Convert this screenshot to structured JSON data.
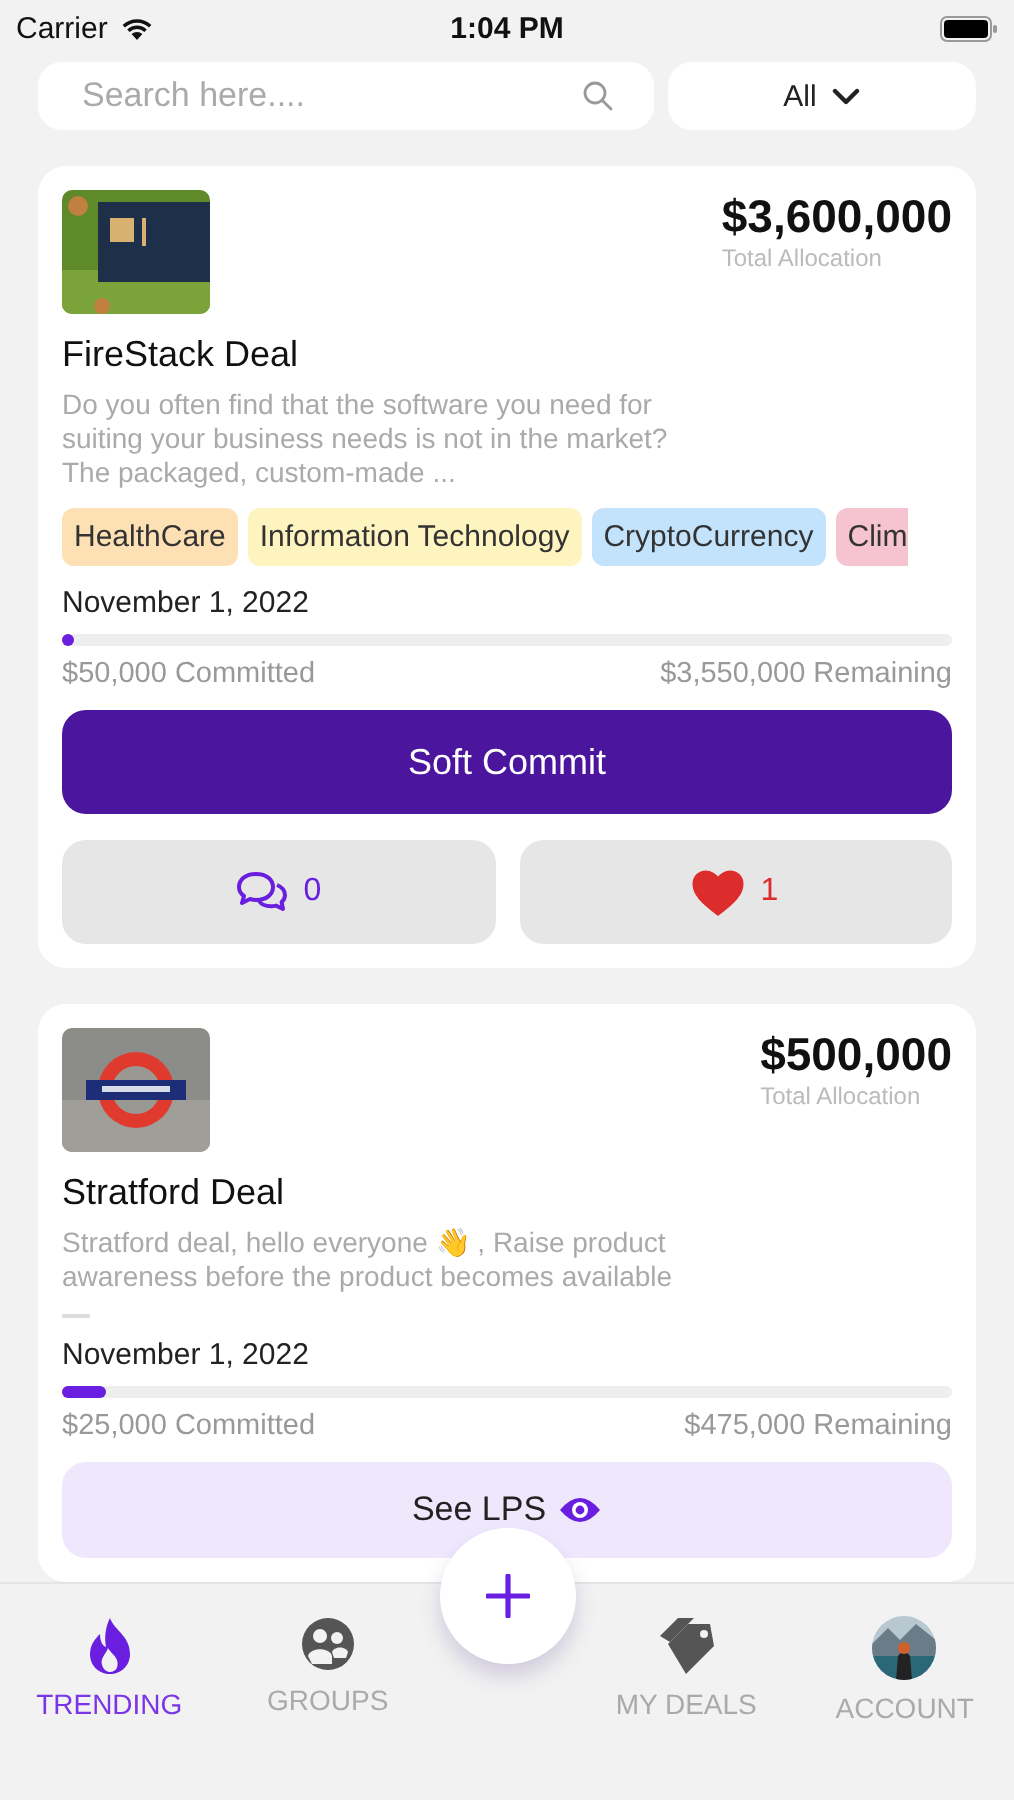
{
  "status_bar": {
    "carrier": "Carrier",
    "time": "1:04 PM"
  },
  "search": {
    "placeholder": "Search here...."
  },
  "filter": {
    "value": "All"
  },
  "deals": [
    {
      "title": "FireStack Deal",
      "amount": "$3,600,000",
      "amount_label": "Total Allocation",
      "description": "Do you often find that the software you need for suiting your business needs is not in the market? The packaged, custom-made ...",
      "tags": [
        {
          "label": "HealthCare",
          "color": "#fde0b4"
        },
        {
          "label": "Information Technology",
          "color": "#fdf4c0"
        },
        {
          "label": "CryptoCurrency",
          "color": "#c3e2fb"
        },
        {
          "label": "Clim",
          "color": "#f6c3d1"
        }
      ],
      "date": "November 1, 2022",
      "level": 0.014,
      "committed": "$50,000 Committed",
      "remaining": "$3,550,000 Remaining",
      "action": {
        "kind": "primary",
        "label": "Soft Commit"
      },
      "comments": "0",
      "likes": "1",
      "liked": true
    },
    {
      "title": "Stratford Deal",
      "amount": "$500,000",
      "amount_label": "Total Allocation",
      "description": "Stratford deal, hello everyone 👋 , Raise product awareness before the product becomes available",
      "date": "November 1, 2022",
      "level": 0.05,
      "committed": "$25,000 Committed",
      "remaining": "$475,000 Remaining",
      "action": {
        "kind": "secondary",
        "label": "See LPS"
      }
    }
  ],
  "tabs": [
    {
      "label": "TRENDING",
      "kind": "flame",
      "selected": true
    },
    {
      "label": "GROUPS",
      "kind": "groups",
      "selected": false
    },
    {
      "label": "MY DEALS",
      "kind": "tags",
      "selected": false
    },
    {
      "label": "ACCOUNT",
      "kind": "avatar",
      "selected": false
    }
  ]
}
